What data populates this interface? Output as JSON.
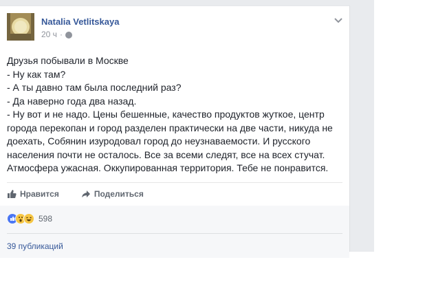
{
  "post": {
    "author": "Natalia Vetlitskaya",
    "time": "20 ч",
    "visibility_separator": "·",
    "body_lines": [
      "Друзья побывали в Москве",
      "- Ну как там?",
      "- А ты давно там была последний раз?",
      "- Да наверно года два назад.",
      "- Ну вот и не надо. Цены бешенные, качество продуктов жуткое, центр",
      "города перекопан и город разделен практически на две части, никуда не",
      "доехать, Собянин изуродовал город до неузнаваемости. И русского",
      "населения почти не осталось. Все за всеми следят, все на всех стучат.",
      "Атмосфера ужасная. Оккупированная территория. Тебе не понравится."
    ]
  },
  "actions": {
    "like_label": "Нравится",
    "share_label": "Поделиться"
  },
  "reactions": {
    "count": "598",
    "icons": [
      "like-reaction",
      "wow-reaction",
      "haha-reaction"
    ],
    "shares_label": "39 публикаций"
  },
  "colors": {
    "author_blue": "#365899",
    "meta_gray": "#90949c",
    "text": "#1d2129",
    "panel_bg": "#f6f7f9",
    "page_bg": "#e9ebee"
  }
}
